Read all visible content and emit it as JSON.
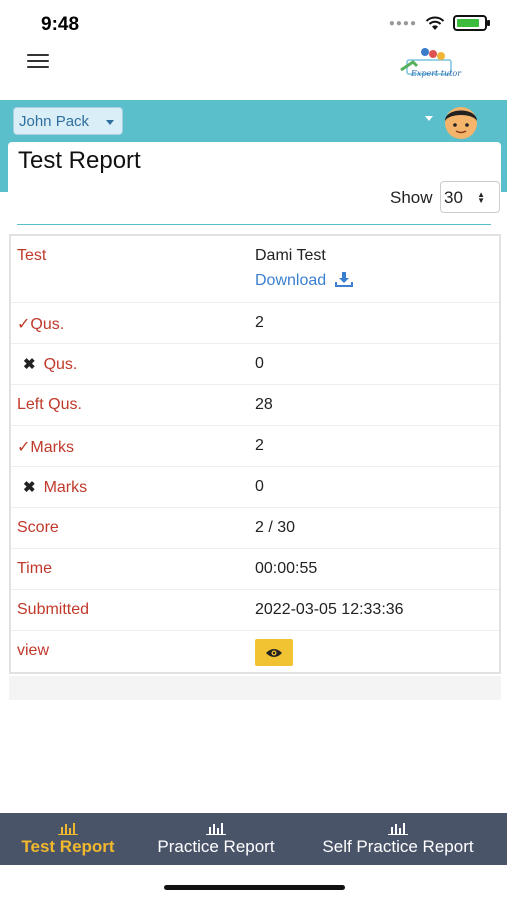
{
  "status_bar": {
    "time": "9:48"
  },
  "header": {
    "logo_text": "Expert tutor",
    "student_name": "John Pack"
  },
  "page": {
    "title": "Test Report",
    "show_label": "Show",
    "show_value": "30"
  },
  "report": {
    "test_label": "Test",
    "test_name": "Dami Test",
    "download_label": "Download",
    "rows": [
      {
        "label": "✓Qus.",
        "value": "2",
        "mark": ""
      },
      {
        "label": "Qus.",
        "value": "0",
        "mark": "✖"
      },
      {
        "label": "Left Qus.",
        "value": "28",
        "mark": ""
      },
      {
        "label": "✓Marks",
        "value": "2",
        "mark": ""
      },
      {
        "label": "Marks",
        "value": "0",
        "mark": "✖"
      },
      {
        "label": "Score",
        "value": "2 / 30",
        "mark": ""
      },
      {
        "label": "Time",
        "value": "00:00:55",
        "mark": ""
      },
      {
        "label": "Submitted",
        "value": "2022-03-05 12:33:36",
        "mark": ""
      }
    ],
    "view_label": "view"
  },
  "bottom_tabs": [
    {
      "label": "Test Report",
      "active": true
    },
    {
      "label": "Practice Report",
      "active": false
    },
    {
      "label": "Self Practice Report",
      "active": false
    }
  ],
  "colors": {
    "accent_teal": "#5bbfcb",
    "label_red": "#c0392b",
    "tab_bar": "#4a5469",
    "active_tab": "#f1b82d",
    "view_button": "#f1c232",
    "link_blue": "#3b7fd0"
  }
}
